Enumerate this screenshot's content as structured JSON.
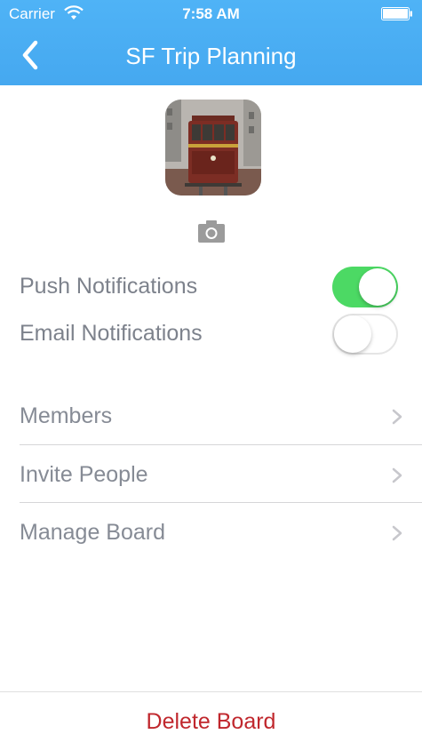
{
  "status_bar": {
    "carrier": "Carrier",
    "time": "7:58 AM"
  },
  "nav": {
    "title": "SF Trip Planning",
    "back_icon": "chevron-left-icon"
  },
  "board": {
    "photo_icon": "cable-car-photo",
    "camera_icon": "camera-icon"
  },
  "settings": {
    "push": {
      "label": "Push Notifications",
      "enabled": true
    },
    "email": {
      "label": "Email Notifications",
      "enabled": false
    }
  },
  "menu": [
    {
      "label": "Members"
    },
    {
      "label": "Invite People"
    },
    {
      "label": "Manage Board"
    }
  ],
  "delete_label": "Delete Board",
  "colors": {
    "header": "#45a8f0",
    "toggle_on": "#4cd964",
    "delete": "#c0272d"
  }
}
